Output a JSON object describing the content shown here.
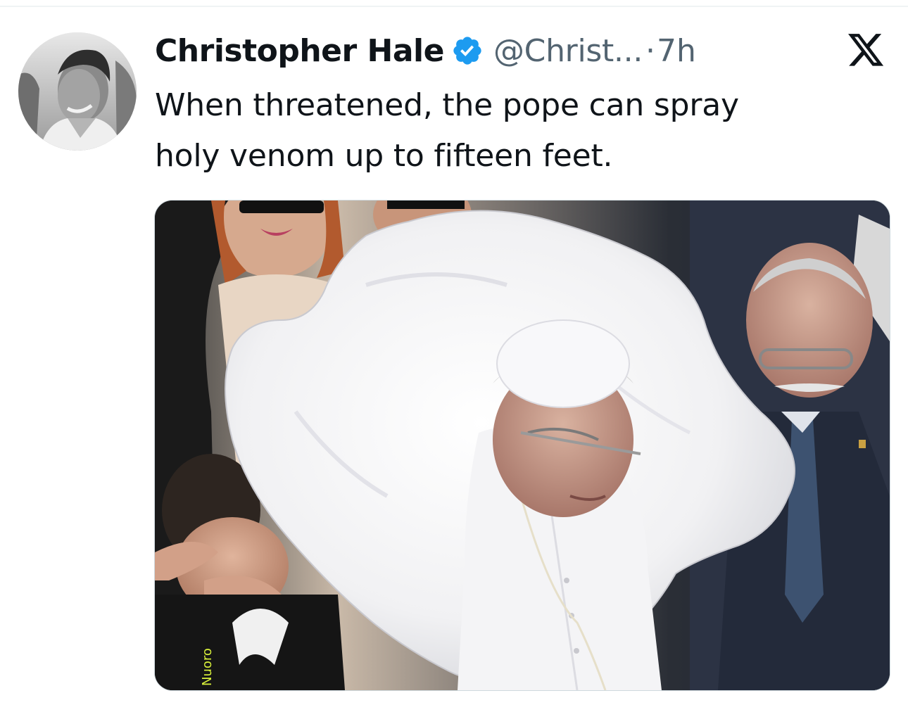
{
  "tweet": {
    "author": {
      "display_name": "Christopher Hale",
      "handle": "@Christ...",
      "verified": true,
      "avatar_icon": "profile-photo"
    },
    "separator": "·",
    "timestamp": "7h",
    "text_lines": [
      "When threatened, the pope can spray",
      "holy venom up to fifteen feet."
    ],
    "media": {
      "description_icon": "photo",
      "shirt_fragment_text": "Nuoro"
    }
  },
  "brand": {
    "logo_icon": "x-logo"
  },
  "colors": {
    "text_primary": "#0f1419",
    "text_secondary": "#536471",
    "verified_blue": "#1d9bf0",
    "divider": "#eff3f4"
  }
}
